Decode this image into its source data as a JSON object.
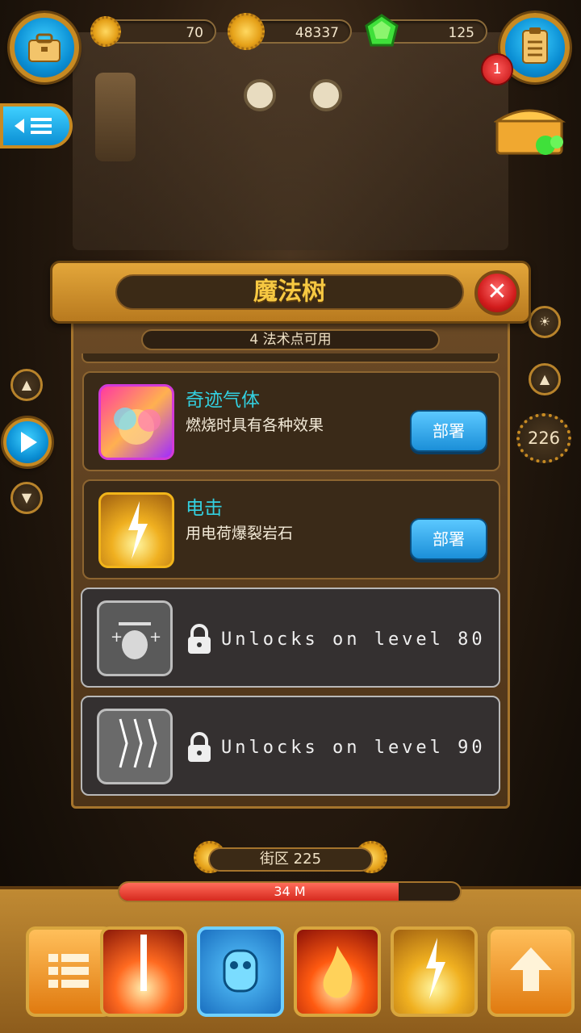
{
  "resources": {
    "gears": "70",
    "coins": "48337",
    "gems": "125"
  },
  "notifications": {
    "quest_badge": "1"
  },
  "panel": {
    "title": "魔法树",
    "points_available": "4 法术点可用",
    "skills": [
      {
        "name": "奇迹气体",
        "description": "燃烧时具有各种效果",
        "button": "部署",
        "locked": false
      },
      {
        "name": "电击",
        "description": "用电荷爆裂岩石",
        "button": "部署",
        "locked": false
      },
      {
        "lock_text": "Unlocks on level 80",
        "locked": true
      },
      {
        "lock_text": "Unlocks on level 90",
        "locked": true
      }
    ]
  },
  "side": {
    "right_depth": "226"
  },
  "bottom": {
    "district": "街区 225",
    "progress_text": "34 M",
    "progress_fraction": 0.82
  },
  "colors": {
    "accent_gold": "#e3a63a",
    "skill_name": "#33d0e0",
    "deploy_button": "#1b8fd8",
    "close_button": "#d21c1c"
  }
}
